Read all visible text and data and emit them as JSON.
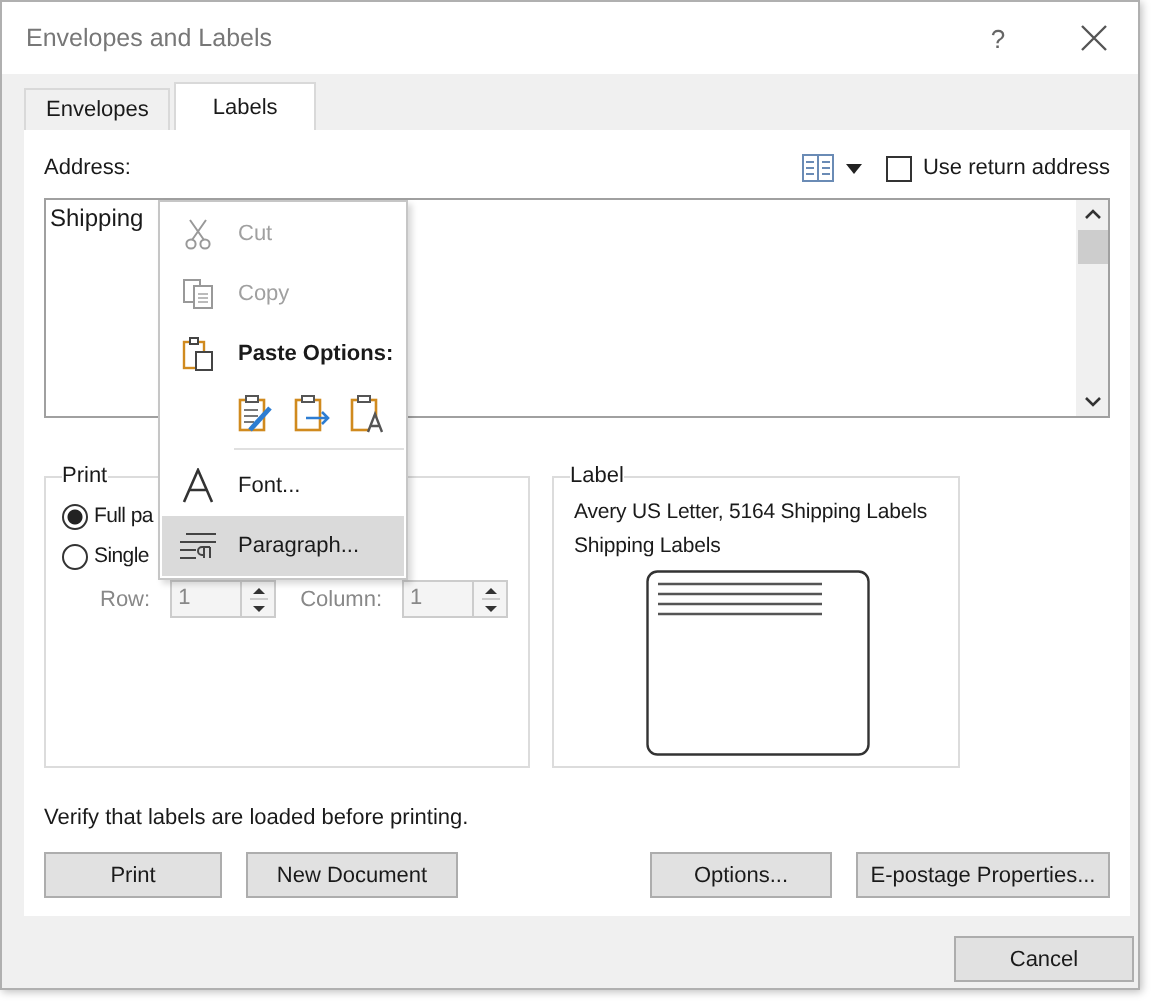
{
  "window": {
    "title": "Envelopes and Labels",
    "help": "?"
  },
  "tabs": [
    {
      "label": "Envelopes",
      "selected": false
    },
    {
      "label": "Labels",
      "selected": true
    }
  ],
  "address": {
    "label": "Address:",
    "value": "Shipping"
  },
  "return_address": {
    "label": "Use return address",
    "checked": false
  },
  "print_group": {
    "title": "Print",
    "options": [
      {
        "label": "Full pa",
        "selected": true
      },
      {
        "label": "Single",
        "selected": false
      }
    ],
    "row": {
      "label": "Row:",
      "value": "1",
      "disabled": true
    },
    "column": {
      "label": "Column:",
      "value": "1",
      "disabled": true
    }
  },
  "label_group": {
    "title": "Label",
    "lines": [
      "Avery US Letter, 5164 Shipping Labels",
      "Shipping Labels"
    ]
  },
  "note": "Verify that labels are loaded before printing.",
  "buttons": [
    "Print",
    "New Document",
    "Options...",
    "E-postage Properties..."
  ],
  "cancel": "Cancel",
  "context_menu": [
    {
      "kind": "cut",
      "label": "Cut",
      "disabled": true,
      "highlighted": false
    },
    {
      "kind": "copy",
      "label": "Copy",
      "disabled": true,
      "highlighted": false
    },
    {
      "kind": "heading",
      "label": "Paste Options:"
    },
    {
      "kind": "paste_buttons"
    },
    {
      "kind": "separator"
    },
    {
      "kind": "font",
      "label": "Font...",
      "disabled": false,
      "highlighted": false
    },
    {
      "kind": "paragraph",
      "label": "Paragraph...",
      "disabled": false,
      "highlighted": true
    }
  ]
}
